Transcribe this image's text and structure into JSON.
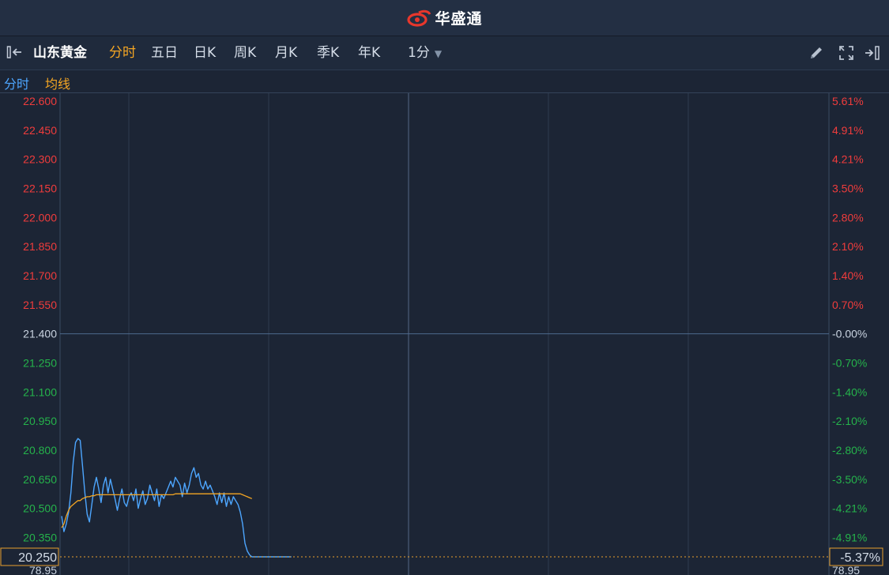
{
  "header": {
    "brand_name": "华盛通"
  },
  "toolbar": {
    "collapse_icon": "collapse-left-icon",
    "stock_name": "山东黄金",
    "periods": [
      {
        "label": "分时",
        "active": true
      },
      {
        "label": "五日",
        "active": false
      },
      {
        "label": "日K",
        "active": false
      },
      {
        "label": "周K",
        "active": false
      },
      {
        "label": "月K",
        "active": false
      },
      {
        "label": "季K",
        "active": false
      },
      {
        "label": "年K",
        "active": false
      }
    ],
    "interval": "1分",
    "interval_icon": "caret-down-icon",
    "tools": [
      "pencil-icon",
      "fullscreen-icon",
      "expand-right-icon"
    ]
  },
  "legend": {
    "price_label": "分时",
    "avg_label": "均线"
  },
  "colors": {
    "background": "#1c2535",
    "grid": "#2e3b50",
    "up": "#f03c3c",
    "down": "#25b34b",
    "neutral": "#c9d3e0",
    "price_line": "#4da6ff",
    "avg_line": "#f5a623"
  },
  "chart_data": {
    "type": "line",
    "title": "",
    "y_ticks": [
      "22.600",
      "22.450",
      "22.300",
      "22.150",
      "22.000",
      "21.850",
      "21.700",
      "21.550",
      "21.400",
      "21.250",
      "21.100",
      "20.950",
      "20.800",
      "20.650",
      "20.500",
      "20.350"
    ],
    "pct_ticks": [
      "5.61%",
      "4.91%",
      "4.21%",
      "3.50%",
      "2.80%",
      "2.10%",
      "1.40%",
      "0.70%",
      "-0.00%",
      "-0.70%",
      "-1.40%",
      "-2.10%",
      "-2.80%",
      "-3.50%",
      "-4.21%",
      "-4.91%"
    ],
    "prev_close": 21.4,
    "ylim": [
      20.25,
      22.6
    ],
    "x_count": 331,
    "current_price_label": "20.250",
    "current_pct_label": "-5.37%",
    "bottom_left_label": "78.95",
    "bottom_right_label": "78.95",
    "series": [
      {
        "name": "分时",
        "x": [
          0,
          1,
          2,
          3,
          4,
          5,
          6,
          7,
          8,
          9,
          10,
          11,
          12,
          13,
          14,
          15,
          16,
          17,
          18,
          19,
          20,
          21,
          22,
          23,
          24,
          25,
          26,
          27,
          28,
          29,
          30,
          31,
          32,
          33,
          34,
          35,
          36,
          37,
          38,
          39,
          40,
          41,
          42,
          43,
          44,
          45,
          46,
          47,
          48,
          49,
          50,
          51,
          52,
          53,
          54,
          55,
          56,
          57,
          58,
          59,
          60,
          61,
          62,
          63,
          64,
          65,
          66,
          67,
          68,
          69,
          70,
          71,
          72,
          73,
          74,
          75,
          76,
          77,
          78,
          79,
          80,
          81,
          82,
          83,
          84,
          85,
          86,
          87,
          88,
          89,
          90,
          91,
          92,
          93,
          94,
          95,
          96,
          97,
          98,
          99
        ],
        "values": [
          20.46,
          20.38,
          20.42,
          20.48,
          20.58,
          20.74,
          20.84,
          20.86,
          20.85,
          20.72,
          20.58,
          20.47,
          20.43,
          20.52,
          20.61,
          20.66,
          20.6,
          20.53,
          20.62,
          20.66,
          20.58,
          20.65,
          20.6,
          20.55,
          20.49,
          20.55,
          20.6,
          20.53,
          20.51,
          20.56,
          20.58,
          20.54,
          20.6,
          20.5,
          20.55,
          20.59,
          20.52,
          20.55,
          20.62,
          20.58,
          20.54,
          20.6,
          20.51,
          20.57,
          20.55,
          20.58,
          20.61,
          20.64,
          20.61,
          20.66,
          20.64,
          20.62,
          20.56,
          20.63,
          20.58,
          20.62,
          20.68,
          20.71,
          20.66,
          20.68,
          20.62,
          20.6,
          20.64,
          20.6,
          20.62,
          20.59,
          20.56,
          20.52,
          20.58,
          20.53,
          20.58,
          20.51,
          20.56,
          20.52,
          20.56,
          20.54,
          20.52,
          20.48,
          20.42,
          20.32,
          20.28,
          20.26,
          20.25,
          20.25,
          20.25,
          20.25,
          20.25,
          20.25,
          20.25,
          20.25,
          20.25,
          20.25,
          20.25,
          20.25,
          20.25,
          20.25,
          20.25,
          20.25,
          20.25,
          20.25
        ]
      },
      {
        "name": "均线",
        "x": [
          0,
          1,
          2,
          3,
          4,
          5,
          6,
          7,
          8,
          9,
          10,
          11,
          12,
          13,
          14,
          15,
          16,
          17,
          18,
          19,
          20,
          21,
          22,
          23,
          24,
          25,
          26,
          27,
          28,
          29,
          30,
          31,
          32,
          33,
          34,
          35,
          36,
          37,
          38,
          39,
          40,
          41,
          42,
          43,
          44,
          45,
          46,
          47,
          48,
          49,
          50,
          51,
          52,
          53,
          54,
          55,
          56,
          57,
          58,
          59,
          60,
          61,
          62,
          63,
          64,
          65,
          66,
          67,
          68,
          69,
          70,
          71,
          72,
          73,
          74,
          75,
          76,
          77,
          78,
          79,
          80,
          81,
          82
        ],
        "values": [
          20.4,
          20.42,
          20.46,
          20.49,
          20.51,
          20.52,
          20.53,
          20.54,
          20.54,
          20.55,
          20.555,
          20.56,
          20.56,
          20.565,
          20.565,
          20.57,
          20.57,
          20.57,
          20.57,
          20.57,
          20.57,
          20.57,
          20.57,
          20.57,
          20.57,
          20.57,
          20.57,
          20.57,
          20.57,
          20.57,
          20.57,
          20.57,
          20.57,
          20.57,
          20.57,
          20.57,
          20.57,
          20.57,
          20.57,
          20.57,
          20.57,
          20.57,
          20.57,
          20.57,
          20.57,
          20.57,
          20.57,
          20.57,
          20.57,
          20.575,
          20.575,
          20.575,
          20.575,
          20.575,
          20.575,
          20.575,
          20.575,
          20.575,
          20.575,
          20.575,
          20.575,
          20.575,
          20.575,
          20.575,
          20.575,
          20.575,
          20.575,
          20.575,
          20.575,
          20.575,
          20.575,
          20.575,
          20.575,
          20.575,
          20.575,
          20.575,
          20.575,
          20.575,
          20.57,
          20.565,
          20.56,
          20.555,
          20.55
        ]
      }
    ]
  }
}
